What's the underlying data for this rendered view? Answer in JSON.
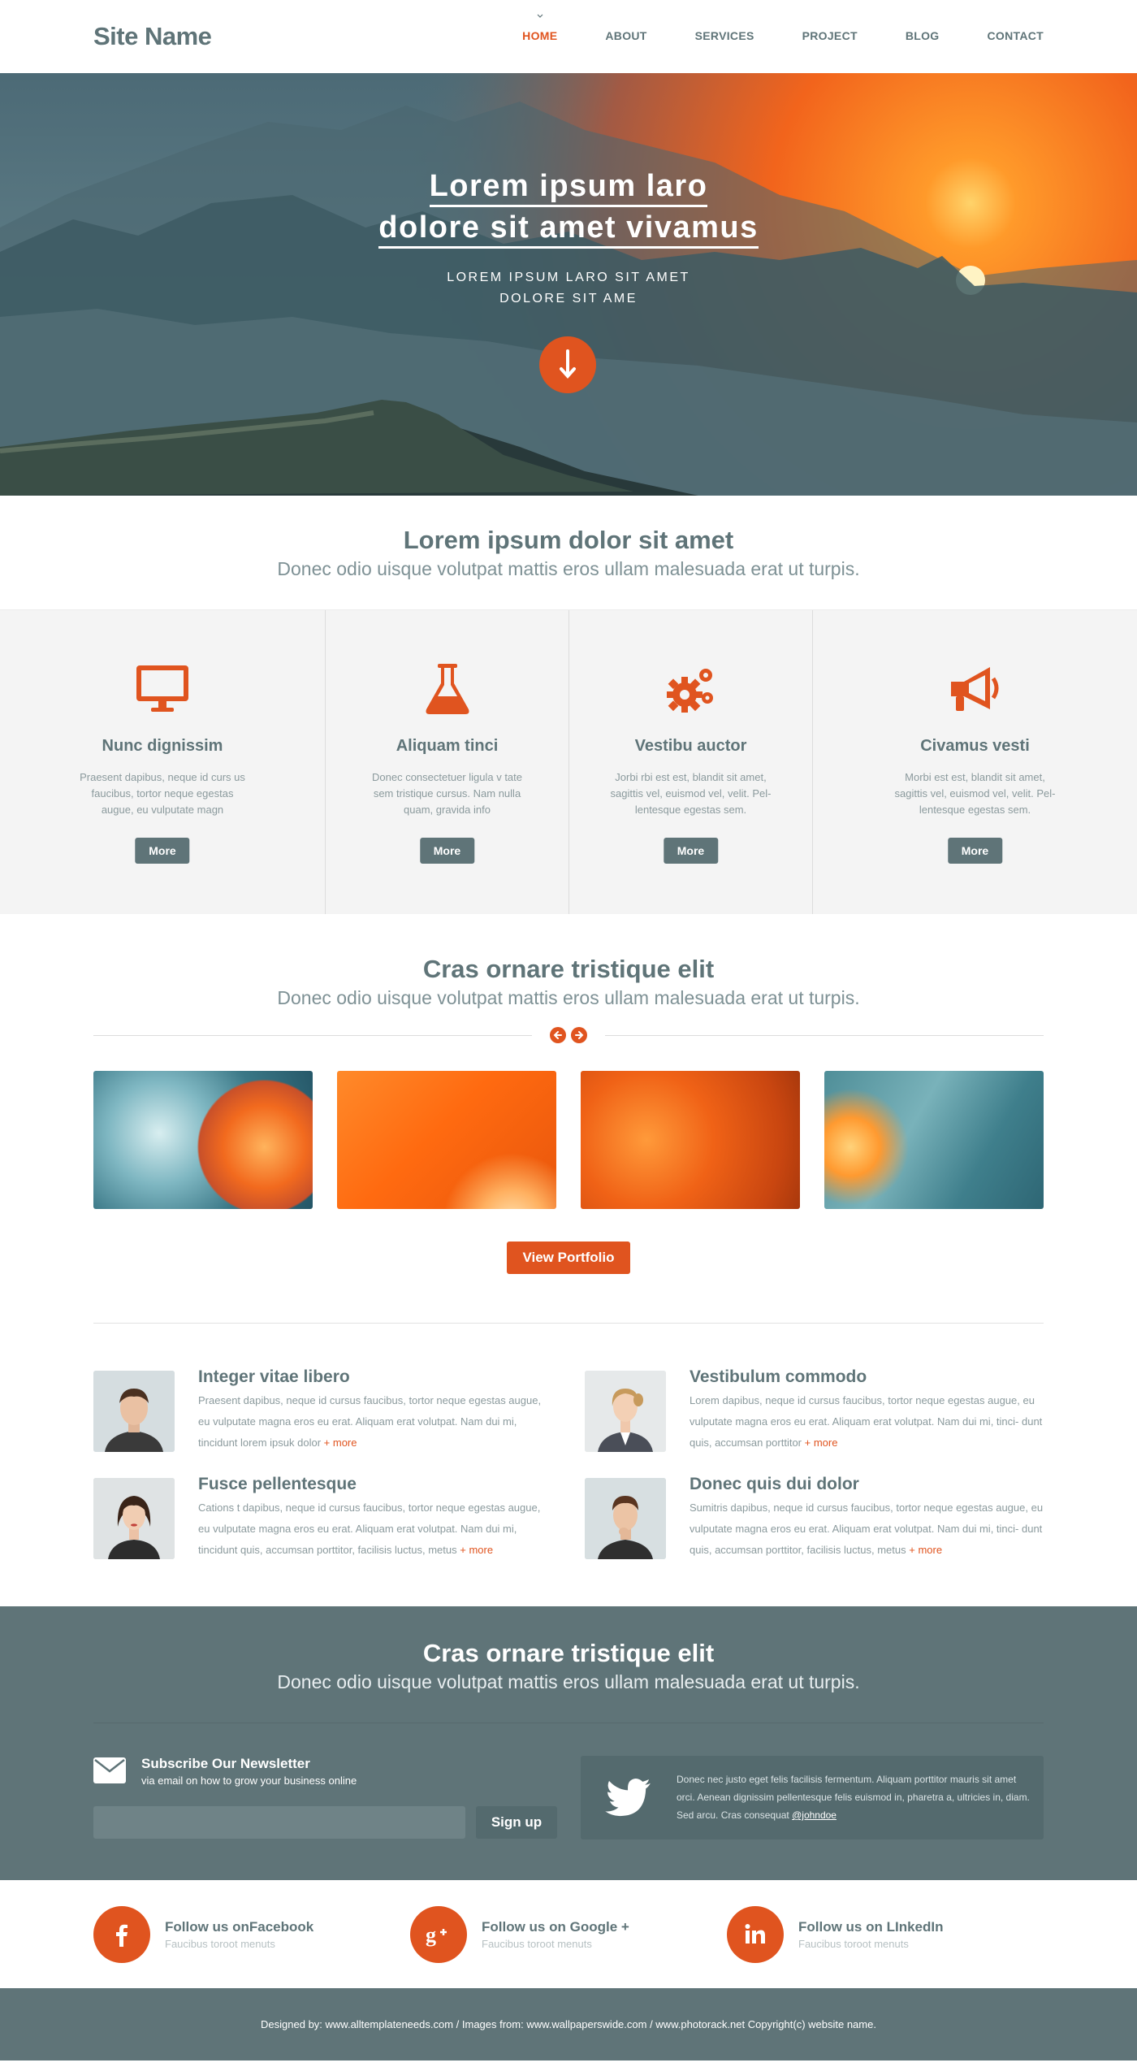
{
  "header": {
    "site_name": "Site Name",
    "nav": [
      "HOME",
      "ABOUT",
      "SERVICES",
      "PROJECT",
      "BLOG",
      "CONTACT"
    ]
  },
  "hero": {
    "title_line1": "Lorem ipsum laro",
    "title_line2": "dolore sit amet vivamus",
    "subtitle_line1": "LOREM IPSUM LARO SIT AMET",
    "subtitle_line2": "DOLORE SIT AME"
  },
  "intro": {
    "heading": "Lorem ipsum dolor sit amet",
    "sub": "Donec odio uisque volutpat mattis eros ullam malesuada erat ut turpis."
  },
  "services": [
    {
      "icon": "monitor-icon",
      "title": "Nunc dignissim",
      "text": "Praesent dapibus, neque id curs us faucibus, tortor neque egestas augue, eu vulputate magn",
      "button": "More"
    },
    {
      "icon": "flask-icon",
      "title": "Aliquam tinci",
      "text": "Donec consectetuer ligula v tate sem tristique cursus. Nam nulla quam, gravida info",
      "button": "More"
    },
    {
      "icon": "gears-icon",
      "title": "Vestibu auctor",
      "text": "Jorbi rbi est est, blandit sit amet, sagittis vel, euismod vel, velit. Pel- lentesque egestas sem.",
      "button": "More"
    },
    {
      "icon": "megaphone-icon",
      "title": "Civamus vesti",
      "text": "Morbi est est, blandit sit amet, sagittis vel, euismod vel, velit. Pel- lentesque egestas sem.",
      "button": "More"
    }
  ],
  "portfolio": {
    "heading": "Cras ornare tristique elit",
    "sub": "Donec odio uisque volutpat mattis eros ullam malesuada erat ut turpis.",
    "button": "View Portfolio"
  },
  "team": [
    {
      "name": "Integer vitae libero",
      "text": "Praesent dapibus, neque id cursus faucibus, tortor neque egestas augue, eu vulputate magna eros eu erat. Aliquam erat volutpat. Nam dui mi, tincidunt lorem ipsuk dolor",
      "more": "+ more"
    },
    {
      "name": "Vestibulum commodo",
      "text": "Lorem dapibus, neque id cursus faucibus, tortor neque egestas augue, eu vulputate magna eros eu erat. Aliquam erat volutpat. Nam dui mi, tinci- dunt quis, accumsan porttitor",
      "more": "+ more"
    },
    {
      "name": "Fusce pellentesque",
      "text": "Cations t dapibus, neque id cursus faucibus, tortor neque egestas augue, eu vulputate magna eros eu erat. Aliquam erat volutpat. Nam dui mi, tincidunt quis, accumsan porttitor, facilisis luctus, metus",
      "more": "+ more"
    },
    {
      "name": "Donec quis dui dolor",
      "text": "Sumitris dapibus, neque id cursus faucibus, tortor neque egestas augue, eu vulputate magna eros eu erat. Aliquam erat volutpat. Nam dui mi, tinci- dunt quis, accumsan porttitor, facilisis luctus, metus",
      "more": "+ more"
    }
  ],
  "newsletter": {
    "heading": "Cras ornare tristique elit",
    "sub": "Donec odio uisque volutpat mattis eros ullam malesuada erat ut turpis.",
    "title": "Subscribe Our Newsletter",
    "desc": "via email on how to grow your business online",
    "input_value": "",
    "button": "Sign up",
    "tweet": "Donec nec justo eget felis facilisis fermentum. Aliquam porttitor mauris sit amet orci. Aenean dignissim pellentesque felis  euismod in, pharetra a, ultricies in, diam. Sed arcu. Cras consequat",
    "tweet_handle": "@johndoe"
  },
  "social": [
    {
      "icon": "facebook-icon",
      "title": "Follow us onFacebook",
      "sub": "Faucibus toroot menuts"
    },
    {
      "icon": "google-plus-icon",
      "title": "Follow us on Google +",
      "sub": "Faucibus toroot menuts"
    },
    {
      "icon": "linkedin-icon",
      "title": "Follow us on LInkedIn",
      "sub": "Faucibus toroot menuts"
    }
  ],
  "footer": {
    "credits": "Designed by: www.alltemplateneeds.com / Images from: www.wallpaperswide.com / www.photorack.net Copyright(c) website name."
  },
  "colors": {
    "accent": "#e0541f",
    "slate": "#5f7478",
    "light_bg": "#f4f4f4"
  }
}
